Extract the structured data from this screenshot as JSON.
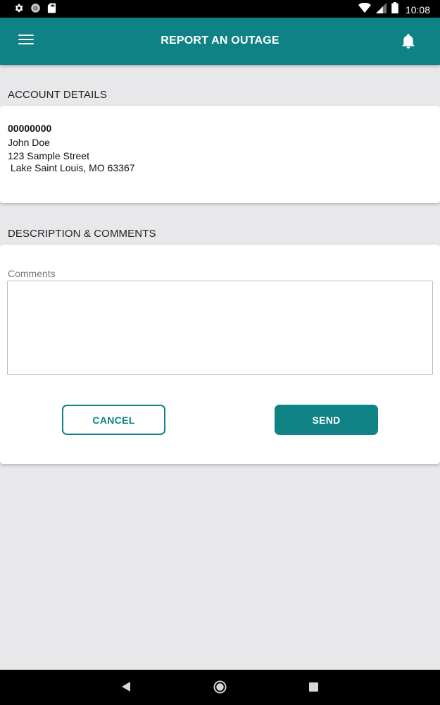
{
  "statusbar": {
    "time": "10:08",
    "icons": [
      "gear-icon",
      "circle-icon",
      "sd-card-icon",
      "wifi-icon",
      "signal-icon",
      "battery-icon"
    ]
  },
  "appbar": {
    "title": "REPORT AN OUTAGE",
    "background": "#0e8285"
  },
  "account": {
    "section_label": "ACCOUNT DETAILS",
    "number": "00000000",
    "name": "John Doe",
    "address_line1": "123 Sample Street",
    "address_line2": " Lake Saint Louis, MO 63367"
  },
  "comments": {
    "section_label": "DESCRIPTION & COMMENTS",
    "field_label": "Comments",
    "value": ""
  },
  "buttons": {
    "cancel_label": "CANCEL",
    "send_label": "SEND"
  },
  "navbar": {
    "icons": [
      "back-icon",
      "home-icon",
      "recents-icon"
    ]
  }
}
